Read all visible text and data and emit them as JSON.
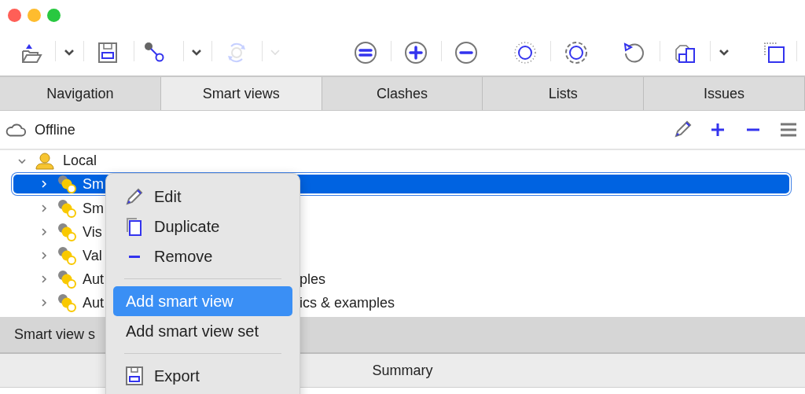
{
  "toolbar": [
    {
      "kind": "open",
      "disabled": false
    },
    {
      "kind": "caret",
      "disabled": false
    },
    {
      "kind": "save",
      "disabled": false
    },
    {
      "kind": "link",
      "disabled": false
    },
    {
      "kind": "caret",
      "disabled": false
    },
    {
      "kind": "sync",
      "disabled": true
    },
    {
      "kind": "caret",
      "disabled": true
    },
    {
      "kind": "equal",
      "disabled": false
    },
    {
      "kind": "plus",
      "disabled": false
    },
    {
      "kind": "minus",
      "disabled": false
    },
    {
      "kind": "dotted",
      "disabled": false
    },
    {
      "kind": "dashed",
      "disabled": false
    },
    {
      "kind": "rotate",
      "disabled": false
    },
    {
      "kind": "boxes",
      "disabled": false
    },
    {
      "kind": "caret",
      "disabled": false
    },
    {
      "kind": "square",
      "disabled": false
    }
  ],
  "tabs": [
    {
      "label": "Navigation",
      "selected": false
    },
    {
      "label": "Smart views",
      "selected": true
    },
    {
      "label": "Clashes",
      "selected": false
    },
    {
      "label": "Lists",
      "selected": false
    },
    {
      "label": "Issues",
      "selected": false
    }
  ],
  "source": {
    "label": "Offline"
  },
  "tree": {
    "label": "Local",
    "expanded": true,
    "children": [
      {
        "text": "Sm",
        "selected": true,
        "expanded": false
      },
      {
        "text": "Sm",
        "selected": false,
        "expanded": false
      },
      {
        "text": "Vis",
        "selected": false,
        "expanded": false
      },
      {
        "text": "Val",
        "selected": false,
        "expanded": false
      },
      {
        "text": "Aut",
        "tail": "ples",
        "selected": false,
        "expanded": false
      },
      {
        "text": "Aut",
        "tail": "ics & examples",
        "selected": false,
        "expanded": false
      }
    ]
  },
  "lower_panel": {
    "title": "Smart view s",
    "column_header": "Summary"
  },
  "context_menu": [
    {
      "kind": "edit",
      "label": "Edit",
      "selected": false
    },
    {
      "kind": "duplicate",
      "label": "Duplicate",
      "selected": false
    },
    {
      "kind": "remove",
      "label": "Remove",
      "selected": false
    },
    {
      "kind": "separator"
    },
    {
      "kind": "plain",
      "label": "Add smart view",
      "selected": true
    },
    {
      "kind": "plain",
      "label": "Add smart view set",
      "selected": false
    },
    {
      "kind": "separator"
    },
    {
      "kind": "export",
      "label": "Export",
      "selected": false
    }
  ]
}
